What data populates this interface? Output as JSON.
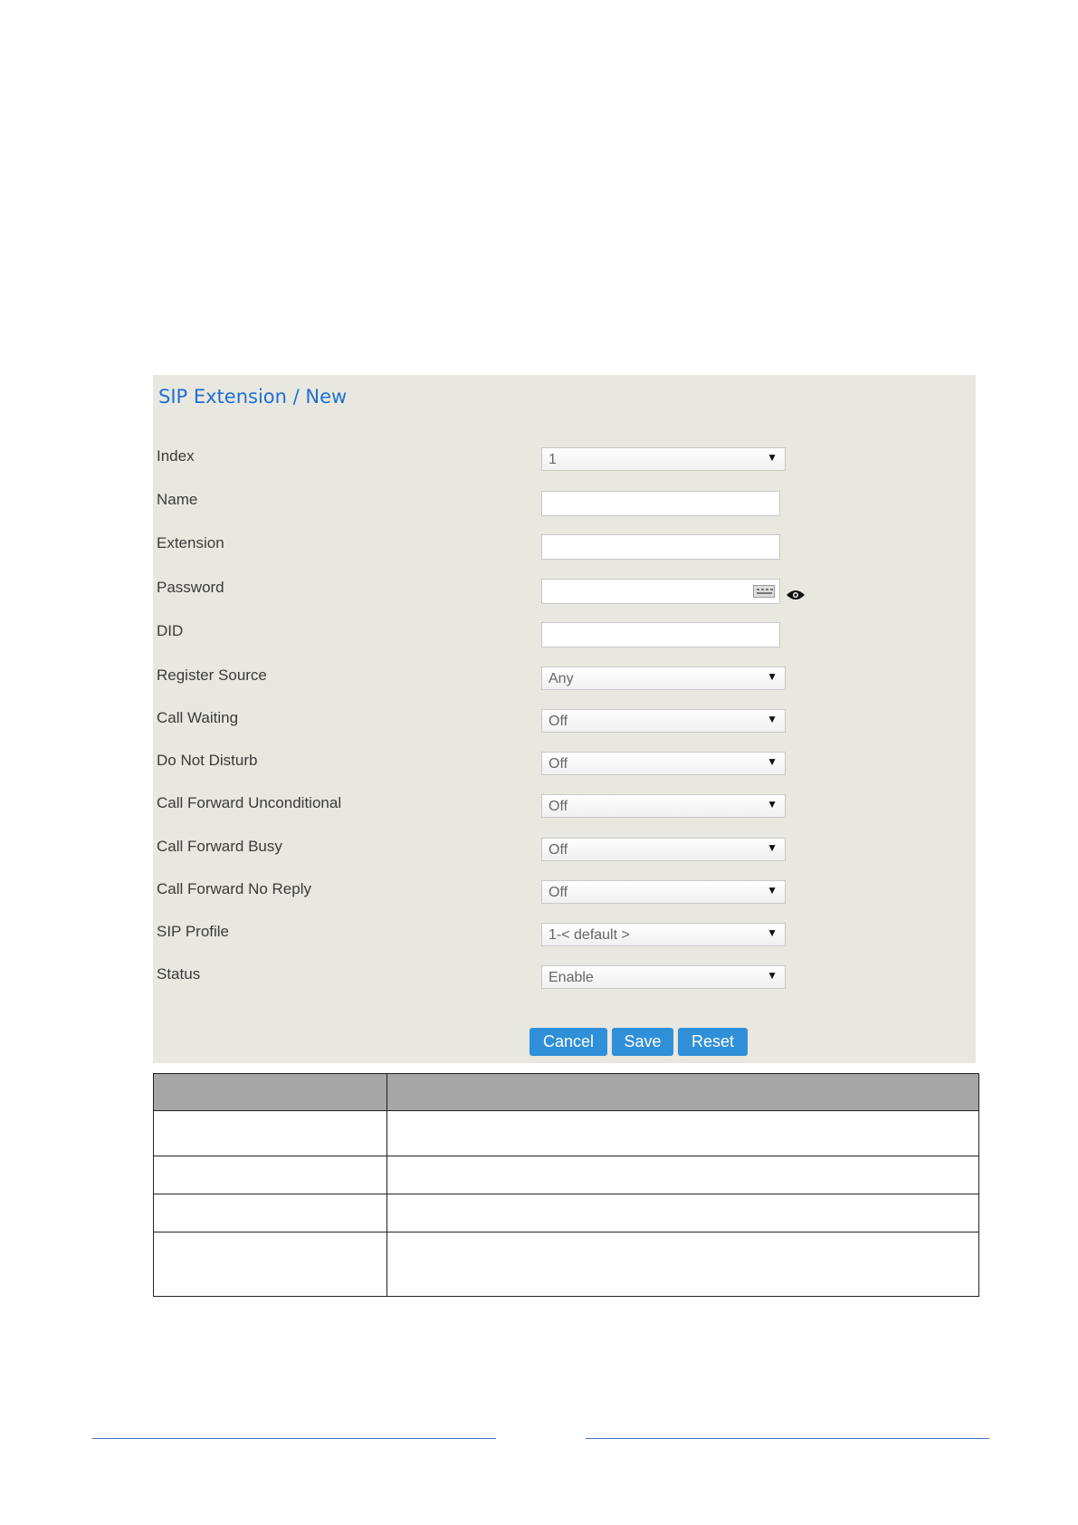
{
  "panel": {
    "title": "SIP Extension / New"
  },
  "form": {
    "index": {
      "label": "Index",
      "value": "1"
    },
    "name": {
      "label": "Name",
      "value": ""
    },
    "extension": {
      "label": "Extension",
      "value": ""
    },
    "password": {
      "label": "Password",
      "value": ""
    },
    "did": {
      "label": "DID",
      "value": ""
    },
    "register_source": {
      "label": "Register Source",
      "value": "Any"
    },
    "call_waiting": {
      "label": "Call Waiting",
      "value": "Off"
    },
    "do_not_disturb": {
      "label": "Do Not Disturb",
      "value": "Off"
    },
    "call_forward_unconditional": {
      "label": "Call Forward Unconditional",
      "value": "Off"
    },
    "call_forward_busy": {
      "label": "Call Forward Busy",
      "value": "Off"
    },
    "call_forward_no_reply": {
      "label": "Call Forward No Reply",
      "value": "Off"
    },
    "sip_profile": {
      "label": "SIP Profile",
      "value": "1-< default >"
    },
    "status": {
      "label": "Status",
      "value": "Enable"
    }
  },
  "buttons": {
    "cancel": "Cancel",
    "save": "Save",
    "reset": "Reset"
  },
  "icons": {
    "keyboard": "keyboard-icon",
    "eye": "eye-icon",
    "dropdown": "triangle-down"
  },
  "colors": {
    "title": "#1f6fcf",
    "button": "#2f8fd8",
    "panel_bg": "#e9e8e0",
    "table_header": "#a6a6a6",
    "footer_rule": "#4472c4"
  }
}
